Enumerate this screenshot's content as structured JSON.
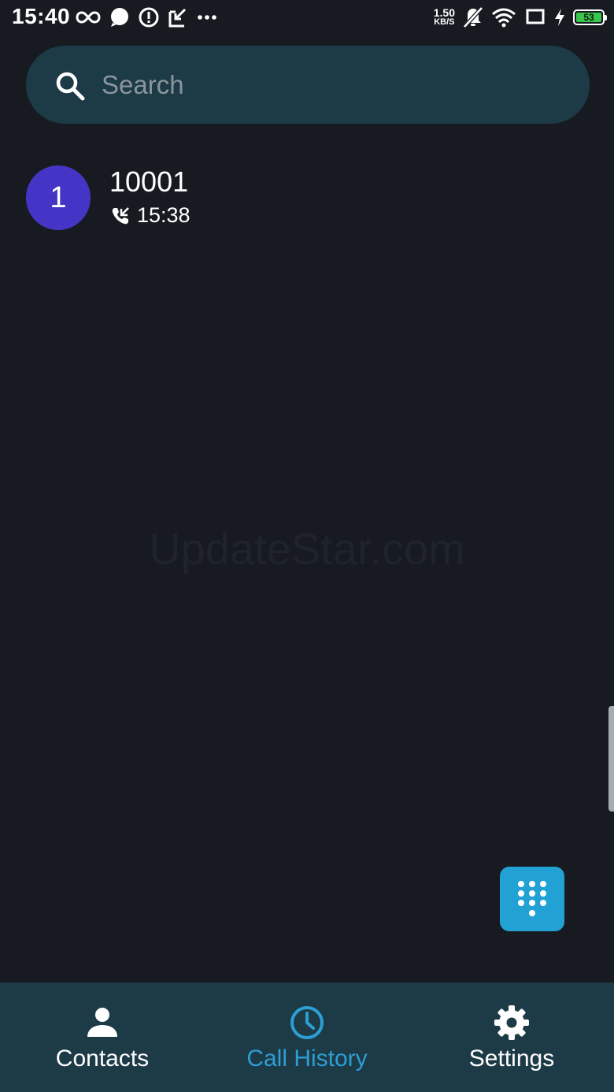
{
  "status_bar": {
    "time": "15:40",
    "left_icons": [
      "infinity-icon",
      "chat-bubble-icon",
      "alert-circle-icon",
      "download-box-icon",
      "more-dots-icon"
    ],
    "net_speed_value": "1.50",
    "net_speed_unit": "KB/S",
    "right_icons": [
      "bell-off-icon",
      "wifi-icon",
      "screen-icon",
      "charging-bolt-icon",
      "battery-icon"
    ],
    "battery_level": "53",
    "battery_color": "#3ac64a"
  },
  "search": {
    "placeholder": "Search"
  },
  "call_history": [
    {
      "avatar_text": "1",
      "avatar_color": "#4535c6",
      "name": "10001",
      "call_icon": "phone-callback-icon",
      "time": "15:38"
    }
  ],
  "watermark": "UpdateStar.com",
  "fab": {
    "icon": "dialpad-icon",
    "color": "#22a2d4"
  },
  "bottom_nav": {
    "active": "call_history",
    "active_color": "#2c9fd3",
    "items": [
      {
        "id": "contacts",
        "label": "Contacts",
        "icon": "person-icon"
      },
      {
        "id": "call_history",
        "label": "Call History",
        "icon": "clock-icon"
      },
      {
        "id": "settings",
        "label": "Settings",
        "icon": "gear-icon"
      }
    ]
  }
}
